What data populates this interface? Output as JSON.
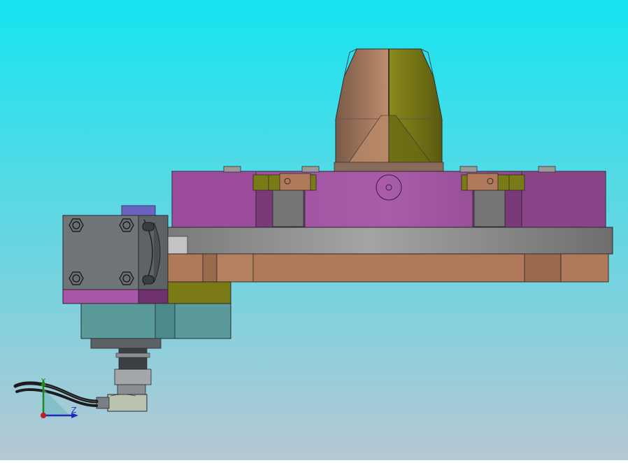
{
  "scene": {
    "description_visible": false,
    "background_top": "#16e4f0",
    "background_bottom": "#b4c8d4"
  },
  "colors": {
    "magenta_body": "#9b4e9b",
    "magenta_dark": "#6d2f6d",
    "gray_plate": "#9a9a9a",
    "copper": "#b07a5a",
    "olive": "#7a7a16",
    "teal": "#5a9a9a",
    "steel": "#707478",
    "blue_cap": "#6a64c0"
  },
  "triad": {
    "z_label": "Z",
    "y_label": "Y",
    "z_color": "#1f2bb8",
    "y_color": "#1a8a1a",
    "origin_color": "#c02020"
  }
}
